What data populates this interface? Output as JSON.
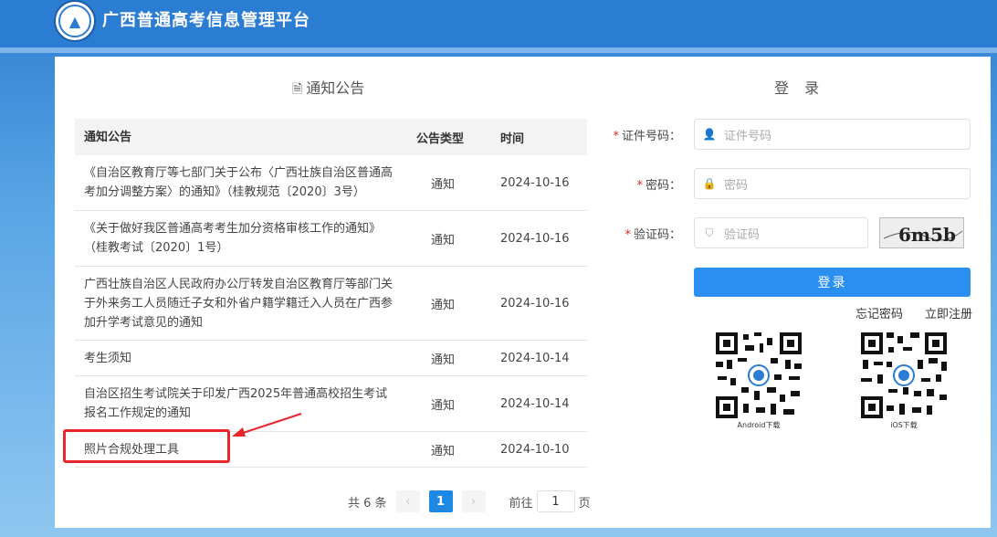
{
  "header": {
    "title": "广西普通高考信息管理平台"
  },
  "notice": {
    "title": "通知公告",
    "columns": [
      "通知公告",
      "公告类型",
      "时间"
    ],
    "rows": [
      {
        "title": "《自治区教育厅等七部门关于公布〈广西壮族自治区普通高考加分调整方案〉的通知》（桂教规范〔2020〕3号）",
        "type": "通知",
        "date": "2024-10-16"
      },
      {
        "title": "《关于做好我区普通高考考生加分资格审核工作的通知》（桂教考试〔2020〕1号）",
        "type": "通知",
        "date": "2024-10-16"
      },
      {
        "title": "广西壮族自治区人民政府办公厅转发自治区教育厅等部门关于外来务工人员随迁子女和外省户籍学籍迁入人员在广西参加升学考试意见的通知",
        "type": "通知",
        "date": "2024-10-16"
      },
      {
        "title": "考生须知",
        "type": "通知",
        "date": "2024-10-14"
      },
      {
        "title": "自治区招生考试院关于印发广西2025年普通高校招生考试报名工作规定的通知",
        "type": "通知",
        "date": "2024-10-14"
      },
      {
        "title": "照片合规处理工具",
        "type": "通知",
        "date": "2024-10-10"
      }
    ],
    "pager": {
      "total_text": "共 6 条",
      "prev": "‹",
      "current": "1",
      "next": "›",
      "goto_prefix": "前往",
      "goto_value": "1",
      "goto_suffix": "页"
    }
  },
  "login": {
    "title": "登 录",
    "id_label": "证件号码：",
    "id_placeholder": "证件号码",
    "password_label": "密码：",
    "password_placeholder": "密码",
    "captcha_label": "验证码：",
    "captcha_placeholder": "验证码",
    "captcha_text": "6m5b",
    "submit": "登录",
    "forgot": "忘记密码",
    "register": "立即注册",
    "android_label": "Android下载",
    "ios_label": "iOS下载"
  },
  "icons": [
    "document-icon",
    "user-icon",
    "lock-icon",
    "shield-icon",
    "arrow-icon",
    "logo-icon"
  ],
  "colors": {
    "primary": "#2b8ff2",
    "header": "#2b7cd3",
    "highlight": "#e8262a"
  }
}
